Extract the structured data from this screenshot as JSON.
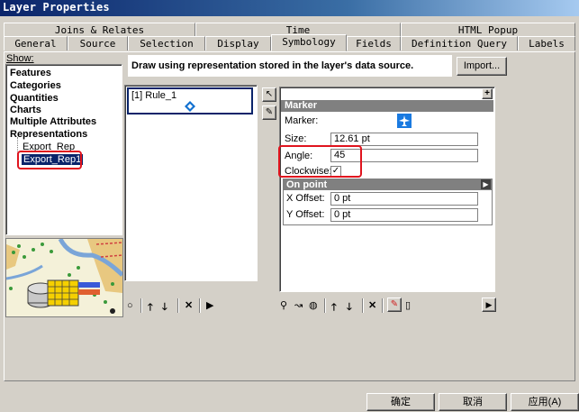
{
  "window": {
    "title": "Layer Properties"
  },
  "tabs_back": [
    {
      "label": "Joins & Relates"
    },
    {
      "label": "Time"
    },
    {
      "label": "HTML Popup"
    }
  ],
  "tabs_front": [
    {
      "label": "General"
    },
    {
      "label": "Source"
    },
    {
      "label": "Selection"
    },
    {
      "label": "Display"
    },
    {
      "label": "Symbology",
      "active": true
    },
    {
      "label": "Fields"
    },
    {
      "label": "Definition Query"
    },
    {
      "label": "Labels"
    }
  ],
  "show": {
    "label": "Show:",
    "items": [
      "Features",
      "Categories",
      "Quantities",
      "Charts",
      "Multiple Attributes",
      "Representations"
    ],
    "subitems": [
      "Export_Rep",
      "Export_Rep1"
    ],
    "selected": "Export_Rep1"
  },
  "description": "Draw using representation stored in the layer's data source.",
  "import_label": "Import...",
  "rules": {
    "items": [
      "[1] Rule_1"
    ]
  },
  "marker": {
    "header": "Marker",
    "marker_label": "Marker:",
    "size_label": "Size:",
    "size_value": "12.61 pt",
    "angle_label": "Angle:",
    "angle_value": "45",
    "clockwise_label": "Clockwise:",
    "clockwise_checked": true
  },
  "onpoint": {
    "header": "On point",
    "xoffset_label": "X Offset:",
    "xoffset_value": "0 pt",
    "yoffset_label": "Y Offset:",
    "yoffset_value": "0 pt"
  },
  "footer": {
    "ok": "确定",
    "cancel": "取消",
    "apply": "应用(A)"
  },
  "colors": {
    "title_bar": "#0a246a",
    "highlight": "#0a246a",
    "red_annotation": "#e0141e",
    "section_header": "#808080"
  },
  "icons": [
    "airplane-icon",
    "diamond-arrows-icon",
    "arrow-up-icon",
    "arrow-down-icon",
    "delete-icon",
    "play-icon"
  ]
}
